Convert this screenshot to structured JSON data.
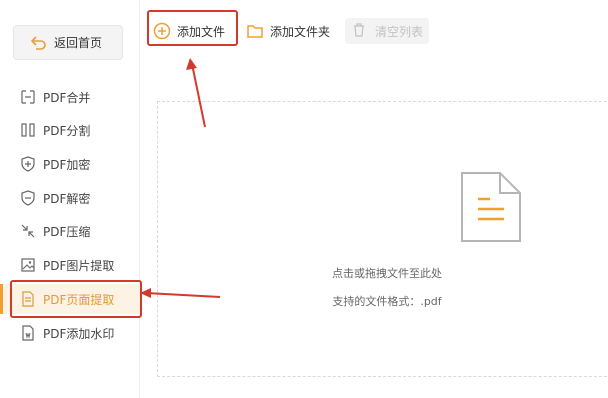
{
  "sidebar": {
    "home_label": "返回首页",
    "items": [
      {
        "label": "PDF合并",
        "icon": "merge-icon"
      },
      {
        "label": "PDF分割",
        "icon": "split-icon"
      },
      {
        "label": "PDF加密",
        "icon": "shield-lock-icon"
      },
      {
        "label": "PDF解密",
        "icon": "shield-unlock-icon"
      },
      {
        "label": "PDF压缩",
        "icon": "compress-icon"
      },
      {
        "label": "PDF图片提取",
        "icon": "image-icon"
      },
      {
        "label": "PDF页面提取",
        "icon": "page-extract-icon",
        "active": true
      },
      {
        "label": "PDF添加水印",
        "icon": "watermark-icon"
      }
    ]
  },
  "toolbar": {
    "add_file_label": "添加文件",
    "add_folder_label": "添加文件夹",
    "clear_list_label": "清空列表"
  },
  "dropzone": {
    "hint": "点击或拖拽文件至此处",
    "formats": "支持的文件格式：.pdf"
  },
  "colors": {
    "accent": "#f0a030",
    "annotation": "#d33a2c",
    "active_bg": "#fdf3e4"
  }
}
